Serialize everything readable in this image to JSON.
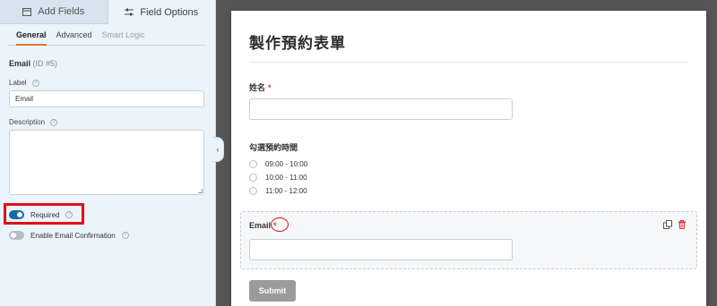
{
  "sidebar": {
    "top_tabs": [
      {
        "label": "Add Fields",
        "icon": "list-icon"
      },
      {
        "label": "Field Options",
        "icon": "sliders-icon"
      }
    ],
    "sub_tabs": [
      "General",
      "Advanced",
      "Smart Logic"
    ],
    "field_name": "Email",
    "field_id": "(ID #5)",
    "label_caption": "Label",
    "label_value": "Email",
    "description_caption": "Description",
    "description_value": "",
    "required_label": "Required",
    "required_on": true,
    "confirmation_label": "Enable Email Confirmation",
    "confirmation_on": false,
    "help_glyph": "?",
    "collapse_glyph": "‹"
  },
  "preview": {
    "form_title": "製作預約表單",
    "name_label": "姓名",
    "required_mark": "*",
    "time_label": "勾選預約時間",
    "time_options": [
      "09:00 - 10:00",
      "10:00 - 11:00",
      "11:00 - 12:00"
    ],
    "email_label": "Email",
    "submit_label": "Submit"
  },
  "colors": {
    "accent": "#e27730",
    "toggle_on": "#0e6ba8",
    "highlight": "#e0101a",
    "required": "#d63638"
  }
}
